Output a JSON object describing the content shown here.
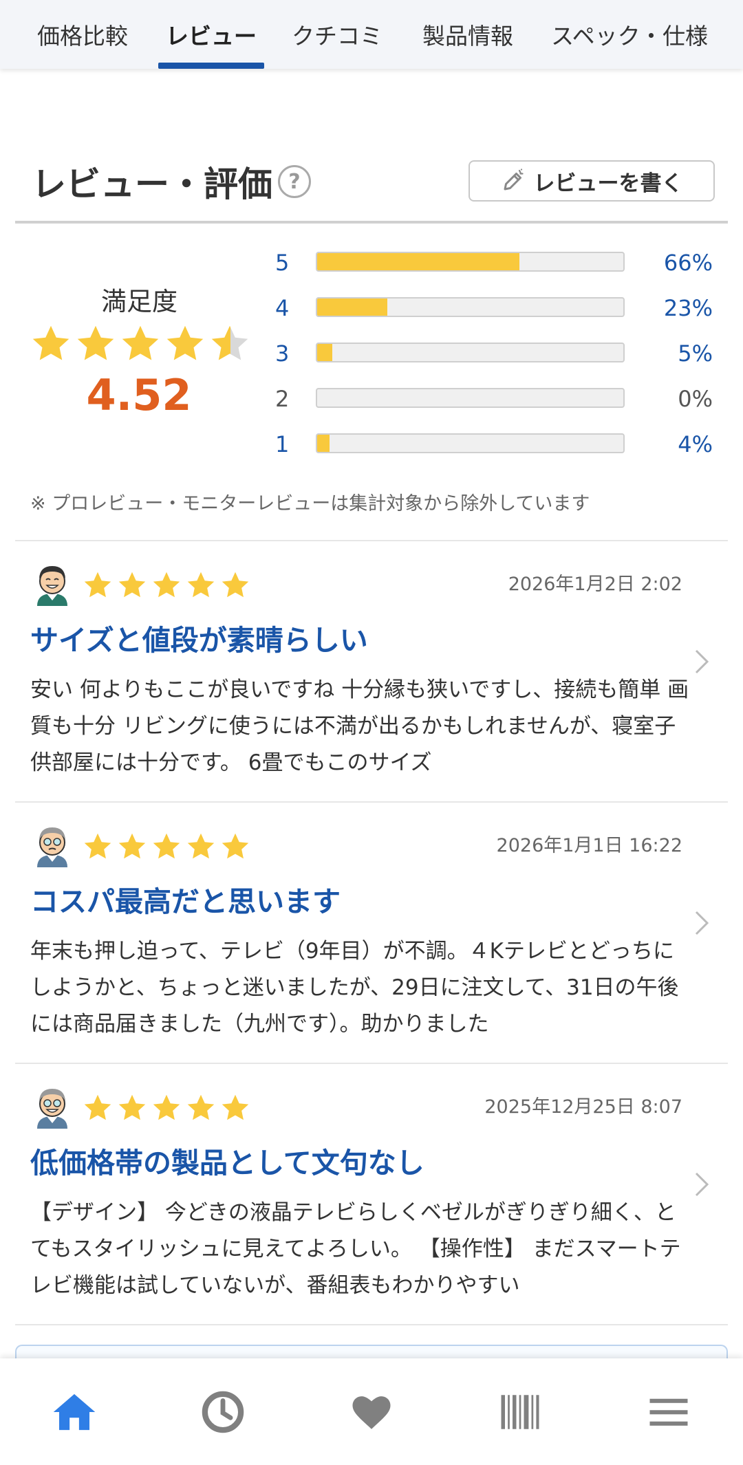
{
  "tabs": [
    {
      "label": "価格比較",
      "active": false
    },
    {
      "label": "レビュー",
      "active": true
    },
    {
      "label": "クチコミ",
      "active": false
    },
    {
      "label": "製品情報",
      "active": false
    },
    {
      "label": "スペック・仕様",
      "active": false
    }
  ],
  "section": {
    "title": "レビュー・評価",
    "help_icon": "question-circle-icon",
    "write_button_label": "レビューを書く",
    "write_button_icon": "pencil-icon"
  },
  "rating": {
    "label": "満足度",
    "score": "4.52",
    "stars_value": 4.52,
    "distribution": [
      {
        "stars": "5",
        "pct_label": "66%",
        "pct": 66
      },
      {
        "stars": "4",
        "pct_label": "23%",
        "pct": 23
      },
      {
        "stars": "3",
        "pct_label": "5%",
        "pct": 5
      },
      {
        "stars": "2",
        "pct_label": "0%",
        "pct": 0
      },
      {
        "stars": "1",
        "pct_label": "4%",
        "pct": 4
      }
    ],
    "note": "※ プロレビュー・モニターレビューは集計対象から除外しています"
  },
  "reviews": [
    {
      "stars": 5,
      "date": "2026年1月2日 2:02",
      "title": "サイズと値段が素晴らしい",
      "body": "安い 何よりもここが良いですね 十分縁も狭いですし、接続も簡単 画質も十分 リビングに使うには不満が出るかもしれませんが、寝室子供部屋には十分です。 6畳でもこのサイズ"
    },
    {
      "stars": 5,
      "date": "2026年1月1日 16:22",
      "title": "コスパ最高だと思います",
      "body": "年末も押し迫って、テレビ（9年目）が不調。４Kテレビとどっちにしようかと、ちょっと迷いましたが、29日に注文して、31日の午後には商品届きました（九州です）。助かりました"
    },
    {
      "stars": 5,
      "date": "2025年12月25日 8:07",
      "title": "低価格帯の製品として文句なし",
      "body": "【デザイン】 今どきの液晶テレビらしくベゼルがぎりぎり細く、とてもスタイリッシュに見えてよろしい。 【操作性】 まだスマートテレビ機能は試していないが、番組表もわかりやすい"
    }
  ],
  "bottom_nav": [
    {
      "icon": "home-icon",
      "active": true
    },
    {
      "icon": "history-clock-icon",
      "active": false
    },
    {
      "icon": "heart-icon",
      "active": false
    },
    {
      "icon": "barcode-icon",
      "active": false
    },
    {
      "icon": "menu-icon",
      "active": false
    }
  ],
  "colors": {
    "accent": "#1a55a8",
    "star": "#f9c93c",
    "score": "#e05f1f",
    "nav_active": "#2f7ee6",
    "nav_inactive": "#808080"
  }
}
